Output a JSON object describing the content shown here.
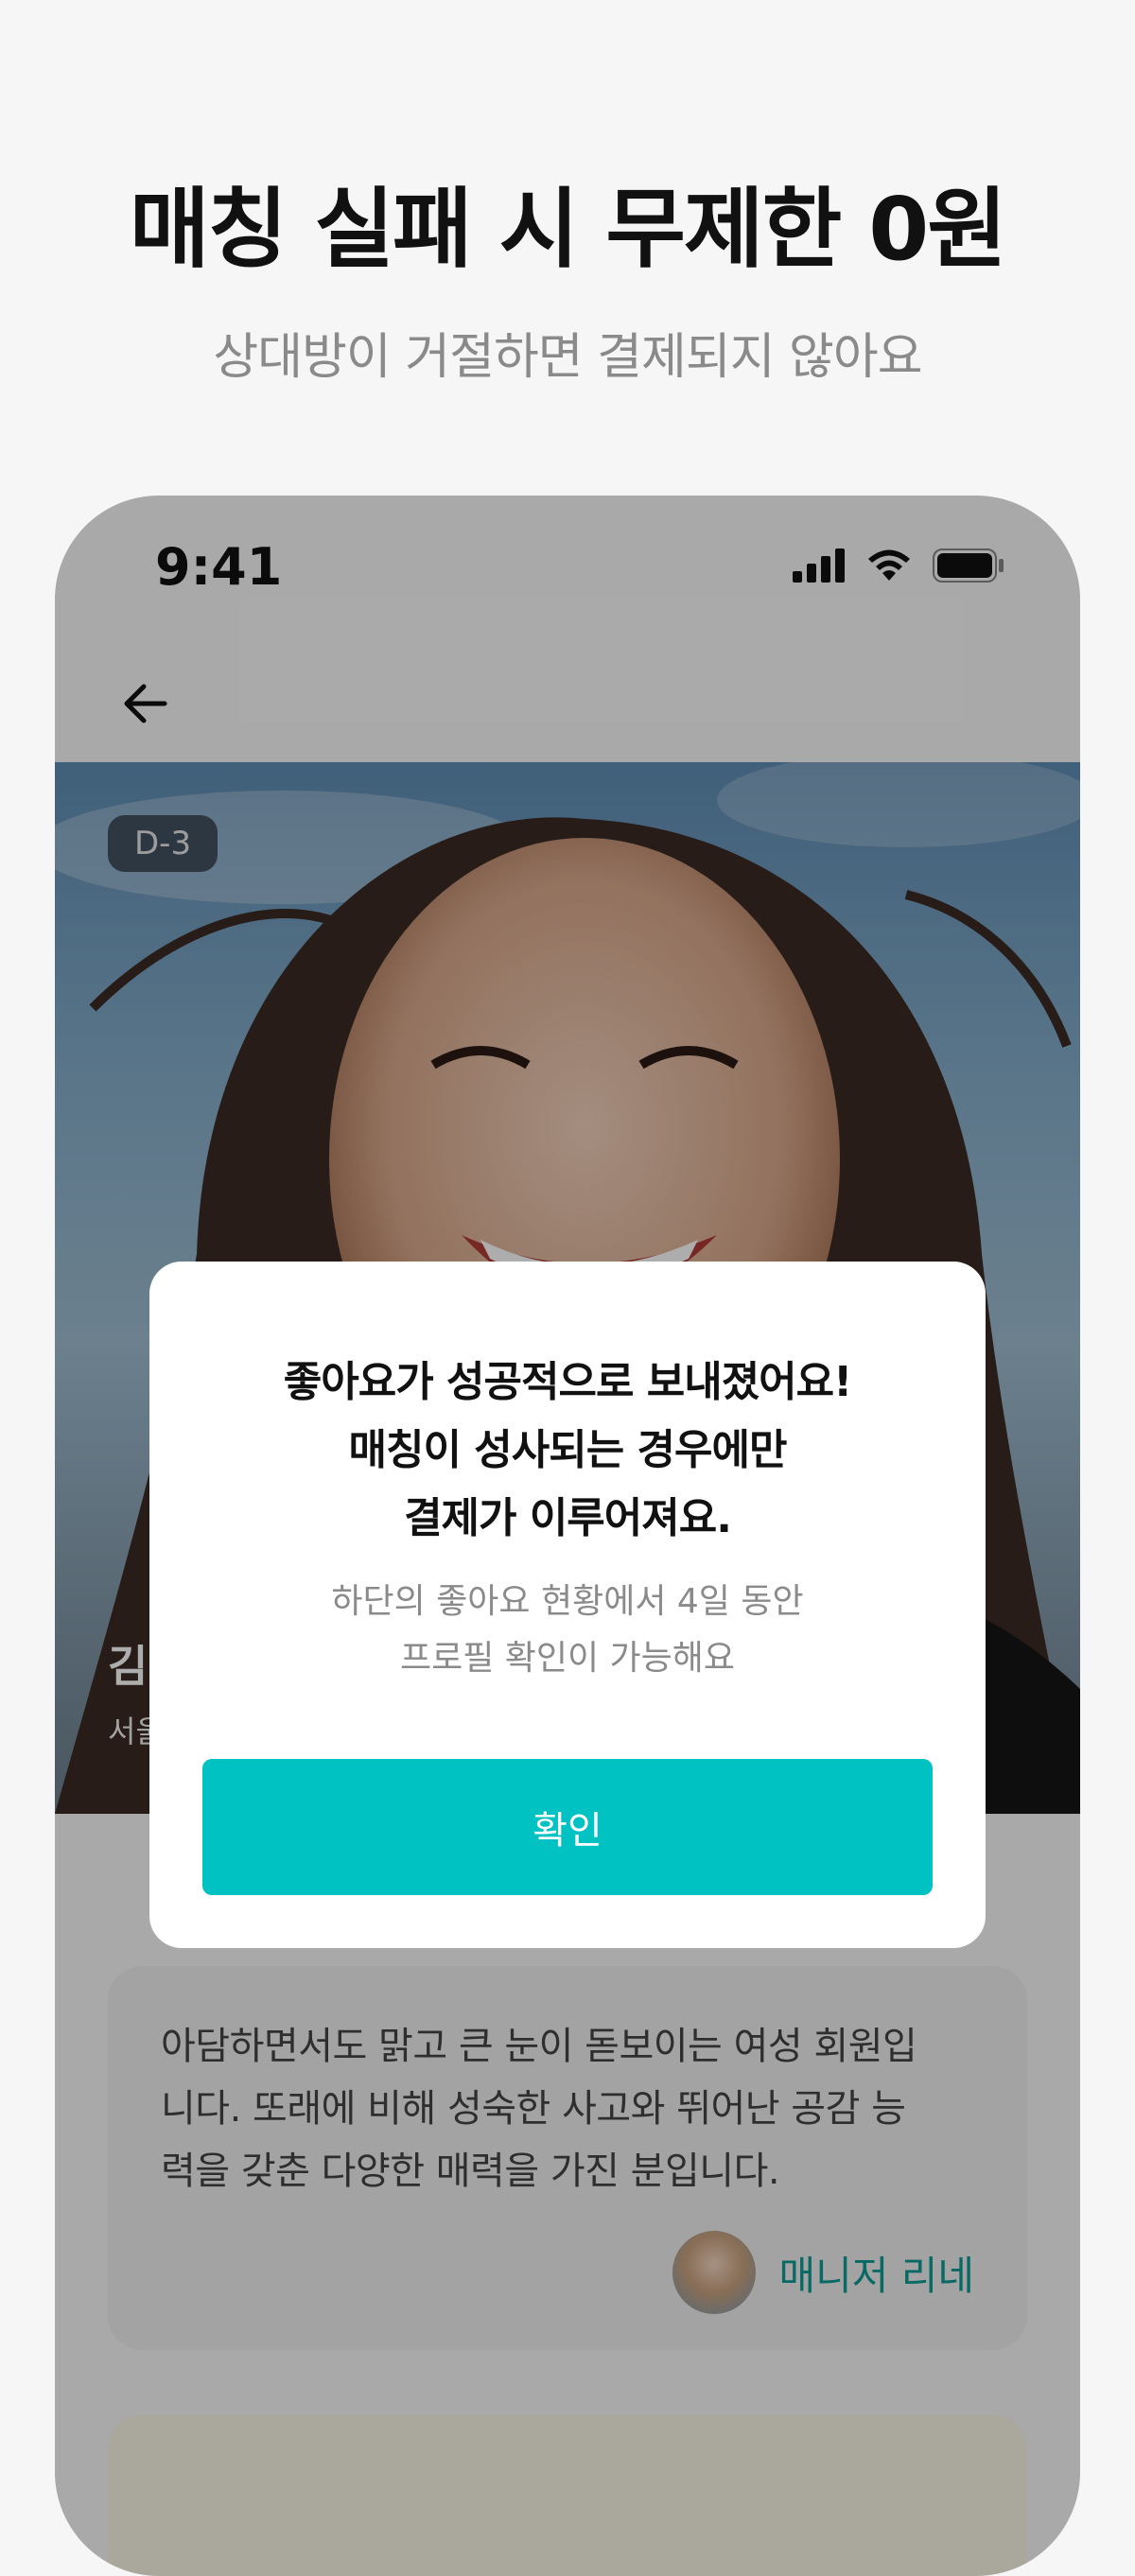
{
  "promo": {
    "headline": "매칭 실패 시 무제한 0원",
    "subline": "상대방이 거절하면 결제되지 않아요"
  },
  "statusbar": {
    "time": "9:41",
    "icons": [
      "cellular-signal-icon",
      "wifi-icon",
      "battery-icon"
    ]
  },
  "nav": {
    "back_icon": "arrow-left-icon"
  },
  "profile": {
    "badge": "D-3",
    "name_partial": "김",
    "location_partial": "서울"
  },
  "description": {
    "lines": [
      "아담하면서도 맑고 큰 눈이 돋보이는 여성 회원입",
      "니다. 또래에 비해 성숙한 사고와 뛰어난 공감 능",
      "력을 갖춘 다양한 매력을 가진 분입니다."
    ],
    "manager_name": "매니저 리네"
  },
  "modal": {
    "title_lines": [
      "좋아요가 성공적으로 보내졌어요!",
      "매칭이 성사되는 경우에만",
      "결제가 이루어져요."
    ],
    "body_lines": [
      "하단의 좋아요 현황에서 4일 동안",
      "프로필 확인이 가능해요"
    ],
    "confirm_label": "확인"
  },
  "colors": {
    "accent": "#00c2c2",
    "manager_text": "#0e9c96",
    "background": "#f6f6f7"
  }
}
